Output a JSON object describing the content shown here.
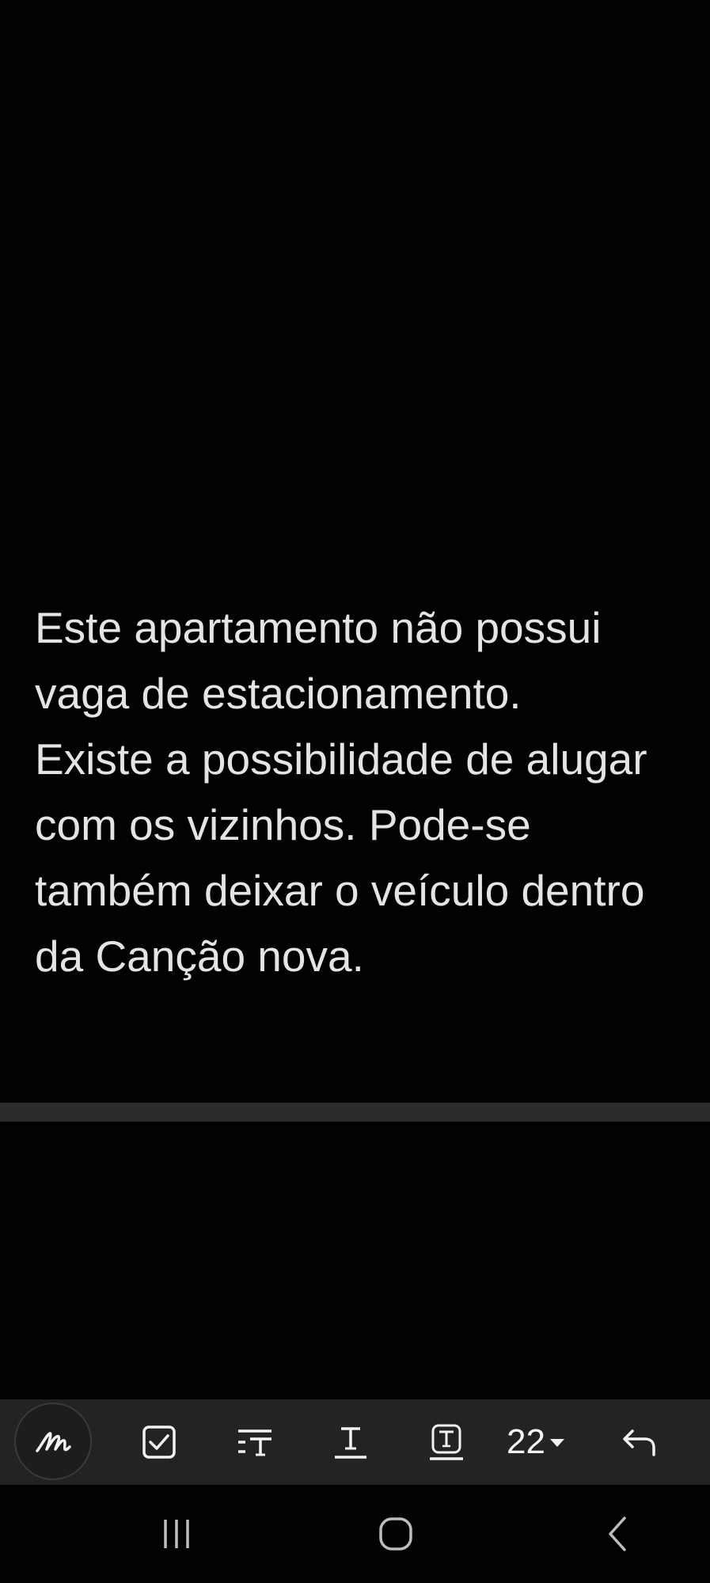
{
  "note": {
    "lines": [
      "Este apartamento não possui",
      "vaga de estacionamento.",
      "Existe a possibilidade de alugar",
      "com os vizinhos. Pode-se",
      "também deixar o veículo dentro",
      "da Canção nova."
    ]
  },
  "toolbar": {
    "font_size": "22",
    "icons": [
      "handwriting-pen-icon",
      "checkbox-icon",
      "text-style-icon",
      "text-underline-icon",
      "text-box-icon",
      "font-size-dropdown",
      "undo-icon"
    ]
  },
  "navbar": {
    "icons": [
      "recent-apps-icon",
      "home-icon",
      "back-icon"
    ]
  },
  "colors": {
    "background": "#020202",
    "text": "#e4e4e4",
    "toolbar": "#232323",
    "divider": "#2b2b2b"
  }
}
